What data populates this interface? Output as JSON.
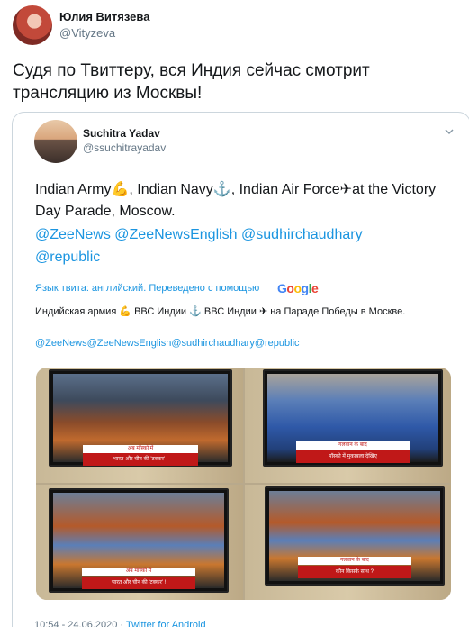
{
  "tweet": {
    "author_name": "Юлия Витязева",
    "author_handle": "@Vityzeva",
    "text": "Судя по Твиттеру, вся Индия сейчас смотрит трансляцию из Москвы!"
  },
  "quoted": {
    "author_name": "Suchitra Yadav",
    "author_handle": "@ssuchitrayadav",
    "text": "Indian Army💪, Indian Navy⚓, Indian Air Force✈at the Victory Day Parade, Moscow.",
    "mentions": [
      "@ZeeNews",
      "@ZeeNewsEnglish",
      "@sudhirchaudhary",
      "@republic"
    ],
    "translate_label": "Язык твита: английский. Переведено с помощью",
    "translate_provider": "Google",
    "translation_text": "Индийская армия 💪 ВВС Индии ⚓ ВВС Индии ✈ на Параде Победы в Москве.",
    "translation_mentions": "@ZeeNews@ZeeNewsEnglish@sudhirchaudhary@republic",
    "photos": [
      {
        "banner_top": "अब मॉस्को में",
        "banner": "भारत और चीन की 'टक्कर' !"
      },
      {
        "banner_top": "गलवान के बाद",
        "banner": "मॉस्को में मुकाबला देखिए"
      },
      {
        "banner_top": "अब मॉस्को में",
        "banner": "भारत और चीन की 'टक्कर' !"
      },
      {
        "banner_top": "गलवान के बाद",
        "banner": "कौन किसके साथ ?"
      }
    ]
  },
  "footer": {
    "timestamp": "10:54 - 24.06.2020",
    "source": "Twitter for Android"
  },
  "colors": {
    "link": "#1b95e0",
    "secondary_text": "#657786",
    "border": "#ccd6dd"
  }
}
